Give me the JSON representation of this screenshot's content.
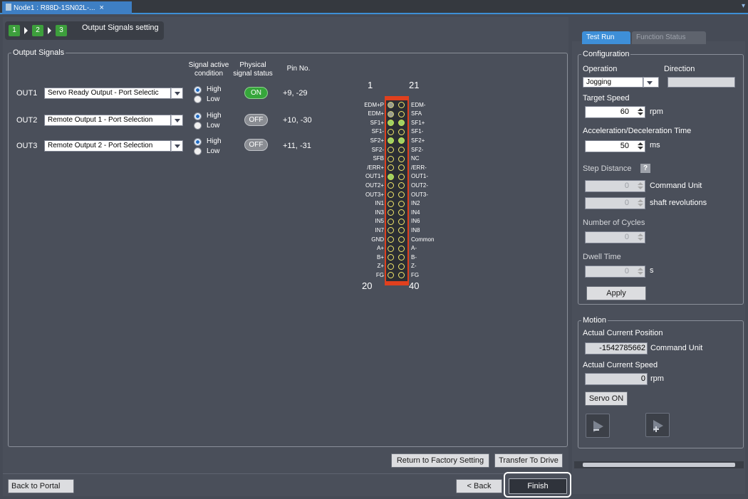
{
  "tab": {
    "title": "Node1 : R88D-1SN02L-...",
    "close": "×"
  },
  "corner_arrow": "▾",
  "steps": {
    "s1": "1",
    "s2": "2",
    "s3": "3",
    "label": "Output Signals setting"
  },
  "output_signals": {
    "legend": "Output Signals",
    "headers": {
      "active1": "Signal active",
      "active2": "condition",
      "phys1": "Physical",
      "phys2": "signal status",
      "pin": "Pin No."
    },
    "rows": [
      {
        "name": "OUT1",
        "selection": "Servo Ready Output - Port Selectic",
        "high": "High",
        "low": "Low",
        "status": "ON",
        "pins": "+9, -29"
      },
      {
        "name": "OUT2",
        "selection": "Remote Output 1 - Port Selection",
        "high": "High",
        "low": "Low",
        "status": "OFF",
        "pins": "+10, -30"
      },
      {
        "name": "OUT3",
        "selection": "Remote Output 2 - Port Selection",
        "high": "High",
        "low": "Low",
        "status": "OFF",
        "pins": "+11, -31"
      }
    ]
  },
  "connector": {
    "top_left": "1",
    "top_right": "21",
    "bottom_left": "20",
    "bottom_right": "40",
    "left_labels": [
      "EDM+P",
      "EDM+",
      "SF1+",
      "SF1-",
      "SF2+",
      "SF2-",
      "SFB",
      "/ERR+",
      "OUT1+",
      "OUT2+",
      "OUT3+",
      "IN1",
      "IN3",
      "IN5",
      "IN7",
      "GND",
      "A+",
      "B+",
      "Z+",
      "FG"
    ],
    "right_labels": [
      "EDM-",
      "SFA",
      "SF1+",
      "SF1-",
      "SF2+",
      "SF2-",
      "NC",
      "/ERR-",
      "OUT1-",
      "OUT2-",
      "OUT3-",
      "IN2",
      "IN4",
      "IN6",
      "IN8",
      "Common",
      "A-",
      "B-",
      "Z-",
      "FG"
    ],
    "left_states": [
      "gr",
      "gr",
      "g",
      "y",
      "g",
      "y",
      "y",
      "y",
      "g",
      "y",
      "y",
      "y",
      "y",
      "y",
      "y",
      "y",
      "y",
      "y",
      "y",
      "y"
    ],
    "right_states": [
      "y",
      "y",
      "g",
      "y",
      "g",
      "y",
      "y",
      "y",
      "y",
      "y",
      "y",
      "y",
      "y",
      "y",
      "y",
      "y",
      "y",
      "y",
      "y",
      "y"
    ]
  },
  "buttons": {
    "factory": "Return to Factory Setting",
    "transfer": "Transfer To Drive",
    "portal": "Back to Portal",
    "back": "< Back",
    "finish": "Finish"
  },
  "right_panel": {
    "tabs": {
      "test_run": "Test Run",
      "function_status": "Function Status"
    },
    "configuration": {
      "legend": "Configuration",
      "operation_label": "Operation",
      "operation_value": "Jogging",
      "direction_label": "Direction",
      "direction_value": "",
      "target_speed_label": "Target Speed",
      "target_speed": "60",
      "target_speed_unit": "rpm",
      "accel_label": "Acceleration/Deceleration Time",
      "accel": "50",
      "accel_unit": "ms",
      "step_label": "Step Distance",
      "step_help": "?",
      "step_cmd": "0",
      "step_cmd_unit": "Command Unit",
      "step_rev": "0",
      "step_rev_unit": "shaft revolutions",
      "cycles_label": "Number of Cycles",
      "cycles": "0",
      "dwell_label": "Dwell Time",
      "dwell": "0",
      "dwell_unit": "s",
      "apply": "Apply"
    },
    "motion": {
      "legend": "Motion",
      "pos_label": "Actual Current Position",
      "pos_value": "-1542785662",
      "pos_unit": "Command Unit",
      "speed_label": "Actual Current Speed",
      "speed_value": "0",
      "speed_unit": "rpm",
      "servo_on": "Servo ON"
    }
  }
}
